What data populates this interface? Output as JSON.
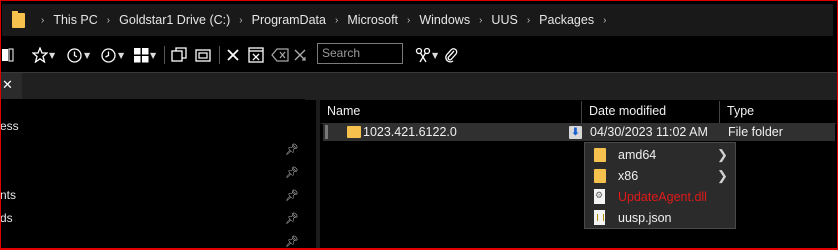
{
  "address_bar": {
    "breadcrumbs": [
      "This PC",
      "Goldstar1 Drive (C:)",
      "ProgramData",
      "Microsoft",
      "Windows",
      "UUS",
      "Packages"
    ],
    "separator": "›"
  },
  "toolbar": {
    "search_placeholder": "Search",
    "icons": [
      "layout-icon",
      "star-icon",
      "history-icon",
      "history2-icon",
      "windows-icon",
      "copy-icon",
      "paste-icon",
      "delete-icon",
      "close-box-icon",
      "backspace-icon",
      "cross-arrow-icon",
      "scissors-icon",
      "paperclip-icon"
    ]
  },
  "tab": {
    "close_label": "✕"
  },
  "nav_pane": {
    "items": [
      "ess",
      "",
      "",
      "nts",
      "ds",
      ""
    ]
  },
  "file_list": {
    "columns": {
      "name": "Name",
      "date_modified": "Date modified",
      "type": "Type"
    },
    "rows": [
      {
        "name": "1023.421.6122.0",
        "date_modified": "04/30/2023 11:02 AM",
        "type": "File folder"
      }
    ]
  },
  "popup": {
    "items": [
      {
        "label": "amd64",
        "kind": "folder",
        "has_submenu": true,
        "highlight": false
      },
      {
        "label": "x86",
        "kind": "folder",
        "has_submenu": true,
        "highlight": false
      },
      {
        "label": "UpdateAgent.dll",
        "kind": "dll",
        "has_submenu": false,
        "highlight": true
      },
      {
        "label": "uusp.json",
        "kind": "json",
        "has_submenu": false,
        "highlight": false
      }
    ]
  },
  "colors": {
    "folder": "#f6c14c",
    "highlight_text": "#e01a1a",
    "frame": "#e00000"
  }
}
